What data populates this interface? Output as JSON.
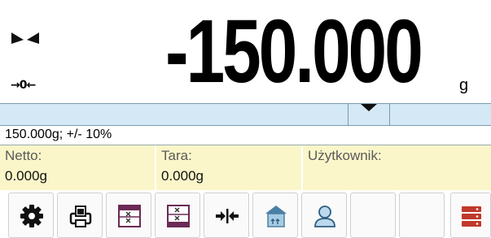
{
  "display": {
    "weight": "-150.000",
    "unit": "g",
    "zero_indicator": "→0←"
  },
  "threshold": {
    "text": "150.000g; +/- 10%"
  },
  "info": [
    {
      "label": "Netto:",
      "value": "0.000g"
    },
    {
      "label": "Tara:",
      "value": "0.000g"
    },
    {
      "label": "Użytkownik:",
      "value": ""
    }
  ],
  "toolbar": {
    "buttons": [
      {
        "icon": "gear-icon"
      },
      {
        "icon": "printer-icon"
      },
      {
        "icon": "threshold-icon"
      },
      {
        "icon": "tare-value-icon"
      },
      {
        "icon": "zero-icon"
      },
      {
        "icon": "packaging-icon"
      },
      {
        "icon": "user-icon"
      },
      {
        "icon": "empty"
      },
      {
        "icon": "empty"
      },
      {
        "icon": "database-icon"
      }
    ]
  },
  "colors": {
    "bargraph": "#d4e9f5",
    "info_background": "#fbf6c9",
    "accent_icon": "#6b2a55",
    "database_icon": "#c0392b"
  }
}
